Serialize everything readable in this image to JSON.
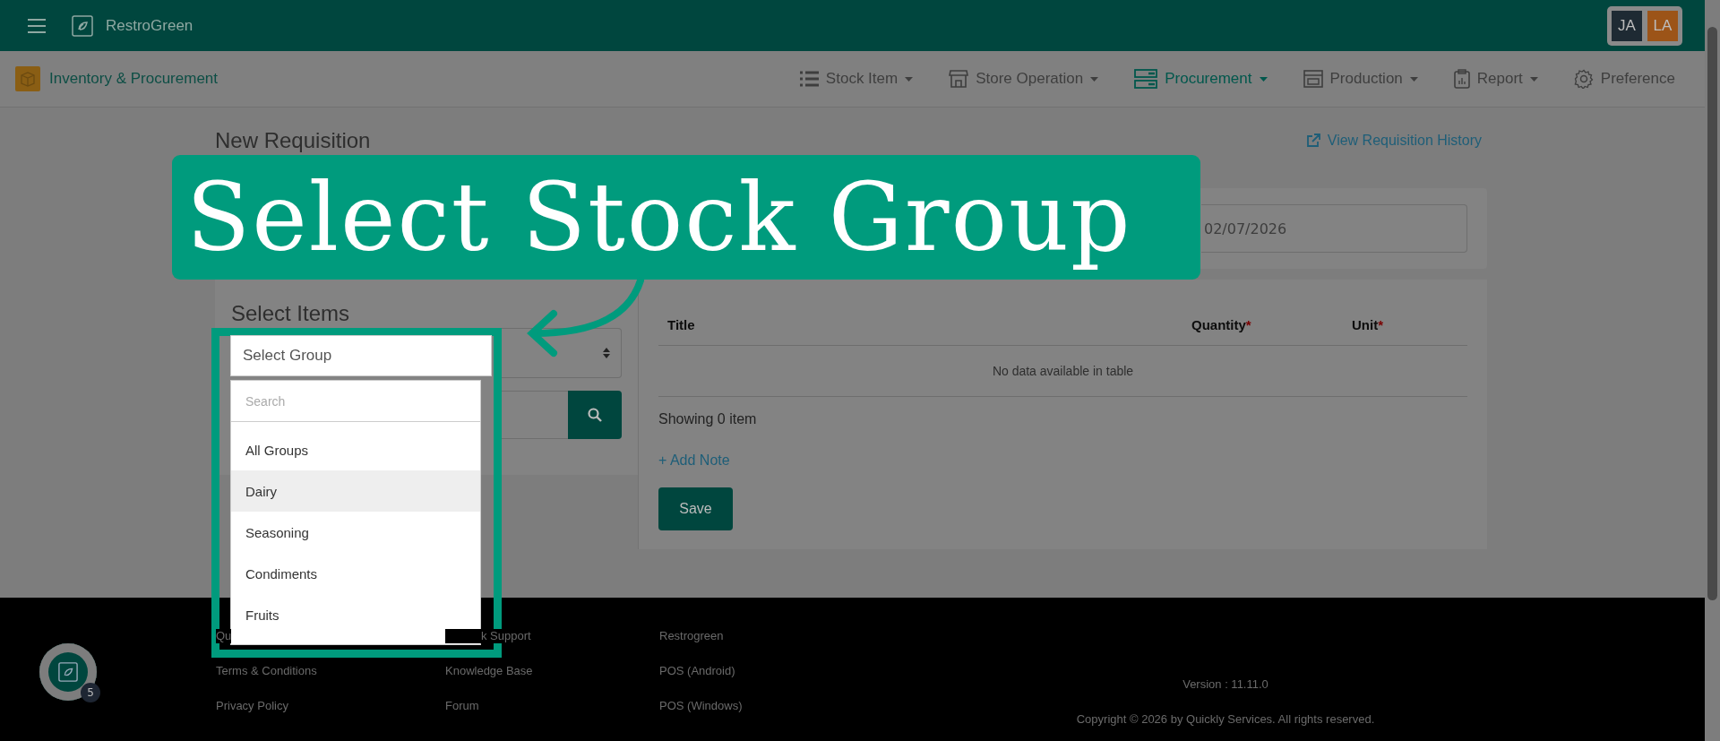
{
  "topbar": {
    "brand": "RestroGreen",
    "avatars": [
      {
        "initials": "JA",
        "color": "#1e2a33"
      },
      {
        "initials": "LA",
        "color": "#9c5418"
      }
    ]
  },
  "subnav": {
    "module": "Inventory & Procurement",
    "menus": [
      {
        "label": "Stock Item",
        "has_menu": true,
        "selected": false
      },
      {
        "label": "Store Operation",
        "has_menu": true,
        "selected": false
      },
      {
        "label": "Procurement",
        "has_menu": true,
        "selected": true
      },
      {
        "label": "Production",
        "has_menu": true,
        "selected": false
      },
      {
        "label": "Report",
        "has_menu": true,
        "selected": false
      },
      {
        "label": "Preference",
        "has_menu": false,
        "selected": false
      }
    ]
  },
  "page": {
    "title": "New Requisition",
    "history_link": "View Requisition History",
    "date": "02/07/2026"
  },
  "select_items": {
    "title": "Select Items",
    "group_select": {
      "placeholder": "Select Group"
    },
    "dropdown": {
      "search_placeholder": "Search",
      "options": [
        {
          "label": "All Groups",
          "selected": false
        },
        {
          "label": "Dairy",
          "selected": true
        },
        {
          "label": "Seasoning",
          "selected": false
        },
        {
          "label": "Condiments",
          "selected": false
        },
        {
          "label": "Fruits",
          "selected": false
        }
      ]
    }
  },
  "table": {
    "columns": [
      {
        "label": "Title"
      },
      {
        "label": "Quantity",
        "mark": "*"
      },
      {
        "label": "Unit",
        "mark": "*"
      }
    ],
    "empty": "No data available in table",
    "count": "Showing 0 item",
    "add_note": "+ Add Note",
    "save": "Save"
  },
  "callout": {
    "text": "Select Stock Group"
  },
  "footer": {
    "columns": [
      [
        "Qu",
        "Terms & Conditions",
        "Privacy Policy"
      ],
      [
        "k Support",
        "Knowledge Base",
        "Forum"
      ],
      [
        "Restrogreen",
        "POS (Android)",
        "POS (Windows)"
      ]
    ],
    "version": "Version : 11.11.0",
    "copyright": "Copyright © 2026 by Quickly Services. All rights reserved."
  },
  "chat": {
    "badge": "5"
  }
}
